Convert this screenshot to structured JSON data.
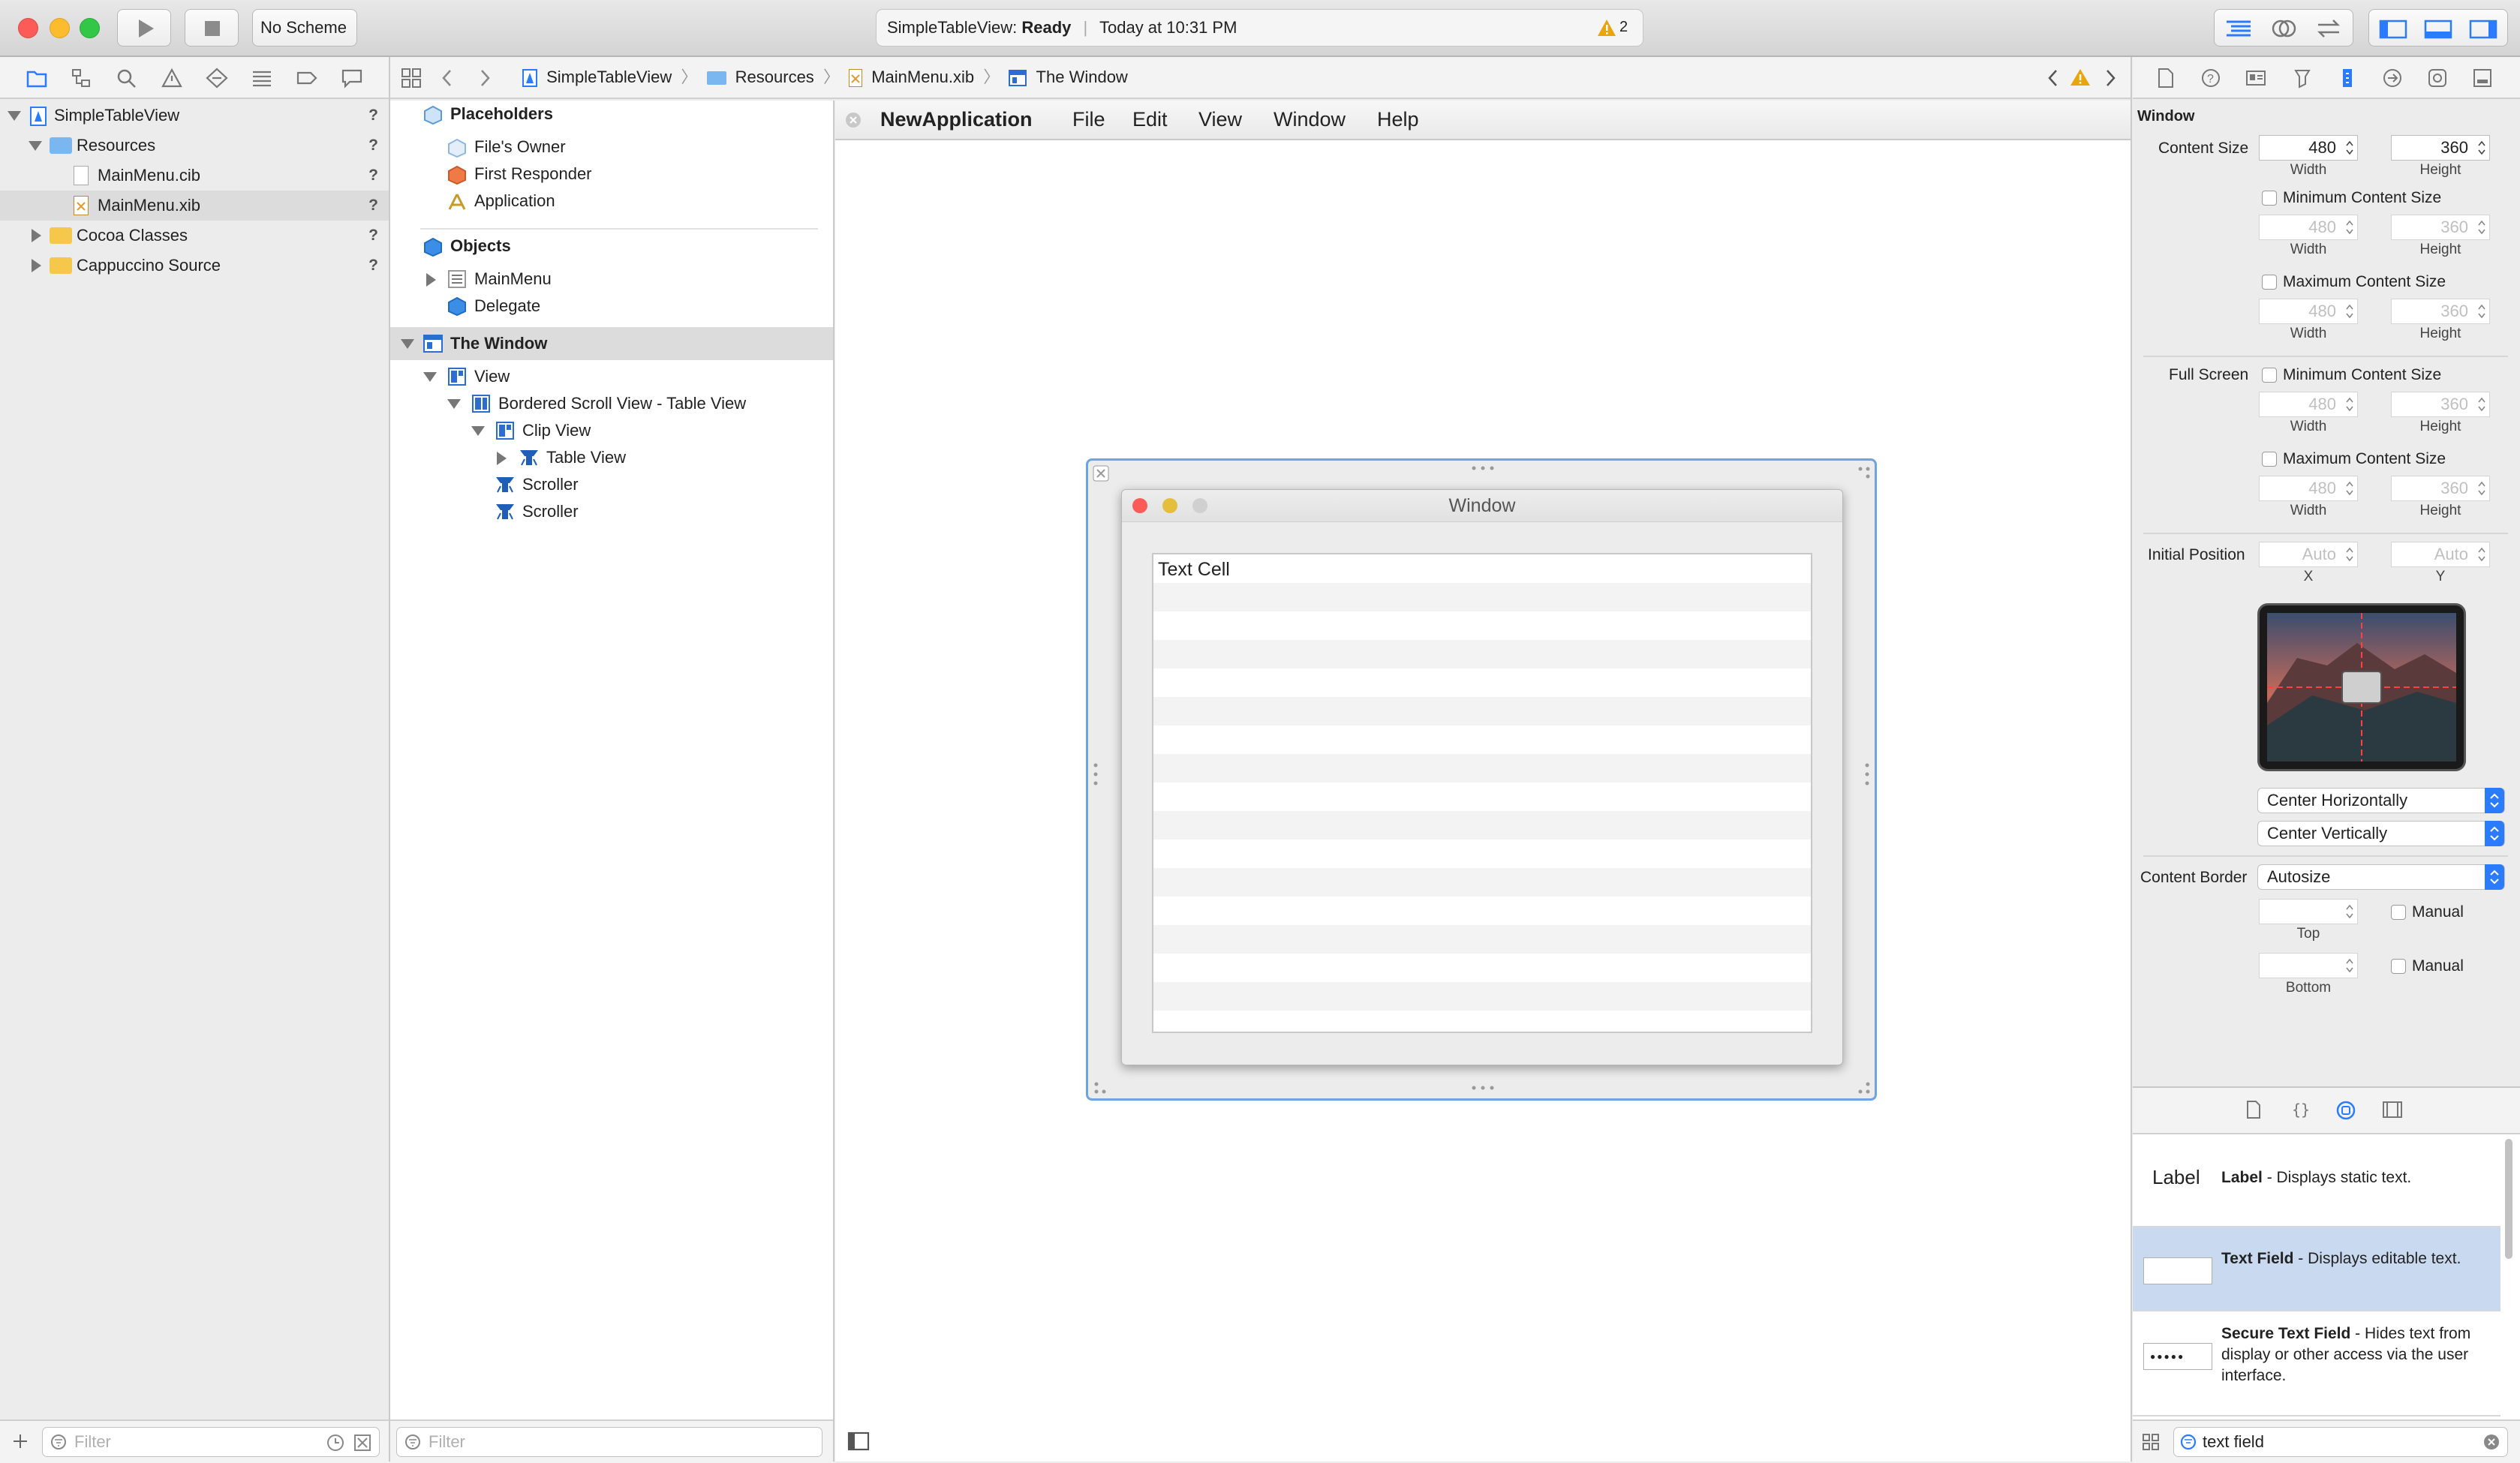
{
  "window": {
    "scheme": "No Scheme",
    "activity_project": "SimpleTableView:",
    "activity_status": "Ready",
    "activity_time": "Today at 10:31 PM",
    "warning_count": "2"
  },
  "jumpbar": {
    "crumbs": [
      "SimpleTableView",
      "Resources",
      "MainMenu.xib",
      "The Window"
    ]
  },
  "navigator": {
    "items": [
      {
        "label": "SimpleTableView",
        "status": "?"
      },
      {
        "label": "Resources",
        "status": "?"
      },
      {
        "label": "MainMenu.cib",
        "status": "?"
      },
      {
        "label": "MainMenu.xib",
        "status": "?"
      },
      {
        "label": "Cocoa Classes",
        "status": "?"
      },
      {
        "label": "Cappuccino Source",
        "status": "?"
      }
    ],
    "filter_placeholder": "Filter"
  },
  "outline": {
    "placeholders_header": "Placeholders",
    "placeholders": [
      "File's Owner",
      "First Responder",
      "Application"
    ],
    "objects_header": "Objects",
    "objects": [
      "MainMenu",
      "Delegate"
    ],
    "window_header": "The Window",
    "tree": [
      "View",
      "Bordered Scroll View - Table View",
      "Clip View",
      "Table View",
      "Scroller",
      "Scroller"
    ],
    "filter_placeholder": "Filter"
  },
  "canvas": {
    "menubar": [
      "NewApplication",
      "File",
      "Edit",
      "View",
      "Window",
      "Help"
    ],
    "window_title": "Window",
    "cell_text": "Text Cell"
  },
  "inspector": {
    "section_title": "Window",
    "content_size_label": "Content Size",
    "width": "480",
    "height": "360",
    "width_label": "Width",
    "height_label": "Height",
    "min_content_size": "Minimum Content Size",
    "max_content_size": "Maximum Content Size",
    "full_screen_label": "Full Screen",
    "initial_position_label": "Initial Position",
    "auto": "Auto",
    "x_label": "X",
    "y_label": "Y",
    "center_h": "Center Horizontally",
    "center_v": "Center Vertically",
    "content_border_label": "Content Border",
    "content_border_value": "Autosize",
    "manual": "Manual",
    "top_label": "Top",
    "bottom_label": "Bottom"
  },
  "library": {
    "items": [
      {
        "preview": "Label",
        "name": "Label",
        "desc": " - Displays static text."
      },
      {
        "preview": "",
        "name": "Text Field",
        "desc": " - Displays editable text."
      },
      {
        "preview": "●●●●●",
        "name": "Secure Text Field",
        "desc": " - Hides text from display or other access via the user interface."
      }
    ],
    "search_value": "text field"
  },
  "colors": {
    "accent": "#2b7bff",
    "selection": "#c9daf0",
    "close": "#fc5b57",
    "minimize": "#e5bf3c",
    "zoom": "#57c038"
  }
}
